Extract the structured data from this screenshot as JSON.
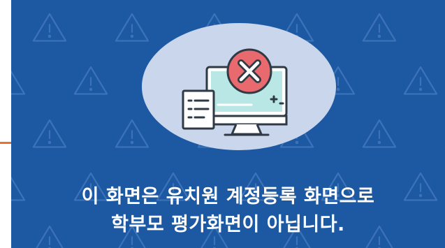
{
  "notice": {
    "line1": "이 화면은 유치원 계정등록 화면으로",
    "line2": "학부모 평가화면이 아닙니다."
  },
  "icons": {
    "background_pattern": "warning-triangle-icon",
    "main": "monitor-error-icon",
    "badge": "close-x-icon",
    "document": "document-list-icon",
    "gamepad": "gamepad-dpad-icon"
  },
  "colors": {
    "background": "#1d58a3",
    "pattern": "#3c72b8",
    "circle": "#c9d6ec",
    "error_circle": "#e96a6e",
    "text": "#ffffff",
    "accent_line": "#e8742c"
  }
}
